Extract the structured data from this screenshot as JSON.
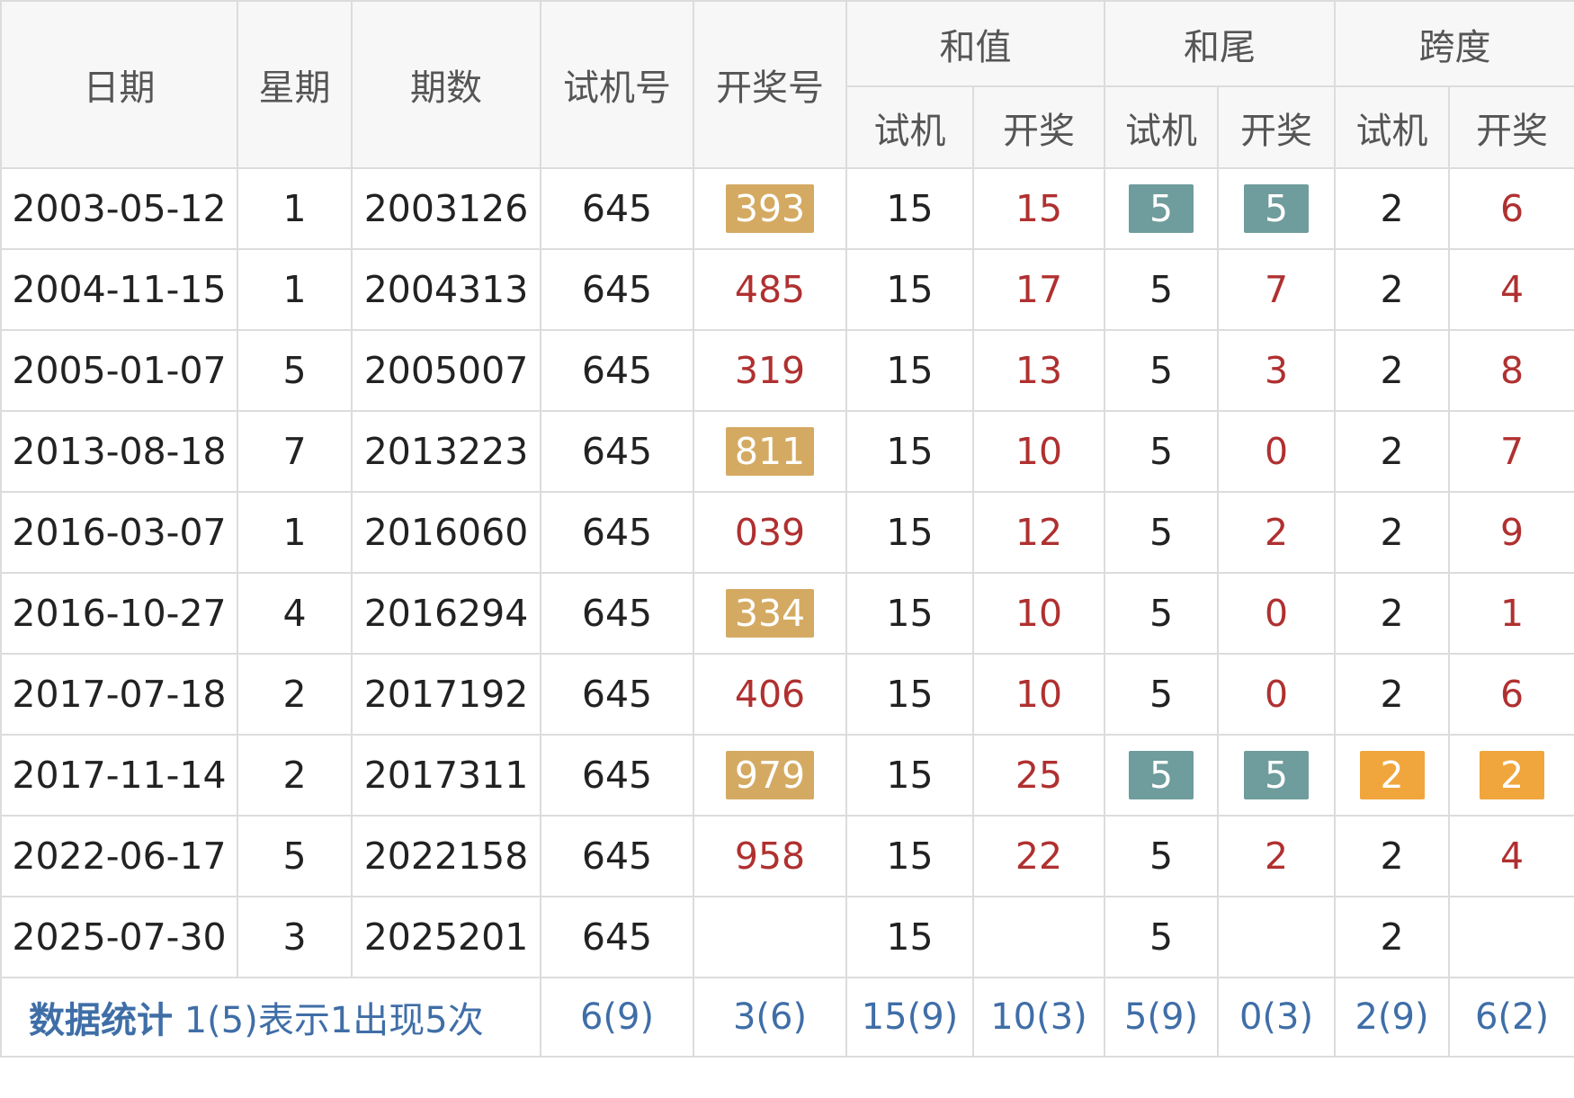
{
  "colors": {
    "header_bg": "#f7f7f7",
    "header_text": "#555555",
    "border": "#dcdcdc",
    "red_text": "#b03030",
    "gold_badge": "#d4aa63",
    "teal_badge": "#6f9c9c",
    "orange_badge": "#f0a63d",
    "stat_text": "#3f6ea7"
  },
  "header": {
    "date": "日期",
    "weekday": "星期",
    "issue": "期数",
    "trial_number": "试机号",
    "draw_number": "开奖号",
    "sum_group": "和值",
    "tail_group": "和尾",
    "span_group": "跨度",
    "sub_trial": "试机",
    "sub_draw": "开奖"
  },
  "rows": [
    {
      "date": "2003-05-12",
      "weekday": "1",
      "issue": "2003126",
      "trial": "645",
      "draw": "393",
      "draw_badge": "gold",
      "sum_trial": "15",
      "sum_draw": "15",
      "tail_trial": "5",
      "tail_trial_badge": "teal",
      "tail_draw": "5",
      "tail_draw_badge": "teal",
      "span_trial": "2",
      "span_trial_badge": "",
      "span_draw": "6",
      "span_draw_badge": ""
    },
    {
      "date": "2004-11-15",
      "weekday": "1",
      "issue": "2004313",
      "trial": "645",
      "draw": "485",
      "draw_badge": "",
      "sum_trial": "15",
      "sum_draw": "17",
      "tail_trial": "5",
      "tail_trial_badge": "",
      "tail_draw": "7",
      "tail_draw_badge": "",
      "span_trial": "2",
      "span_trial_badge": "",
      "span_draw": "4",
      "span_draw_badge": ""
    },
    {
      "date": "2005-01-07",
      "weekday": "5",
      "issue": "2005007",
      "trial": "645",
      "draw": "319",
      "draw_badge": "",
      "sum_trial": "15",
      "sum_draw": "13",
      "tail_trial": "5",
      "tail_trial_badge": "",
      "tail_draw": "3",
      "tail_draw_badge": "",
      "span_trial": "2",
      "span_trial_badge": "",
      "span_draw": "8",
      "span_draw_badge": ""
    },
    {
      "date": "2013-08-18",
      "weekday": "7",
      "issue": "2013223",
      "trial": "645",
      "draw": "811",
      "draw_badge": "gold",
      "sum_trial": "15",
      "sum_draw": "10",
      "tail_trial": "5",
      "tail_trial_badge": "",
      "tail_draw": "0",
      "tail_draw_badge": "",
      "span_trial": "2",
      "span_trial_badge": "",
      "span_draw": "7",
      "span_draw_badge": ""
    },
    {
      "date": "2016-03-07",
      "weekday": "1",
      "issue": "2016060",
      "trial": "645",
      "draw": "039",
      "draw_badge": "",
      "sum_trial": "15",
      "sum_draw": "12",
      "tail_trial": "5",
      "tail_trial_badge": "",
      "tail_draw": "2",
      "tail_draw_badge": "",
      "span_trial": "2",
      "span_trial_badge": "",
      "span_draw": "9",
      "span_draw_badge": ""
    },
    {
      "date": "2016-10-27",
      "weekday": "4",
      "issue": "2016294",
      "trial": "645",
      "draw": "334",
      "draw_badge": "gold",
      "sum_trial": "15",
      "sum_draw": "10",
      "tail_trial": "5",
      "tail_trial_badge": "",
      "tail_draw": "0",
      "tail_draw_badge": "",
      "span_trial": "2",
      "span_trial_badge": "",
      "span_draw": "1",
      "span_draw_badge": ""
    },
    {
      "date": "2017-07-18",
      "weekday": "2",
      "issue": "2017192",
      "trial": "645",
      "draw": "406",
      "draw_badge": "",
      "sum_trial": "15",
      "sum_draw": "10",
      "tail_trial": "5",
      "tail_trial_badge": "",
      "tail_draw": "0",
      "tail_draw_badge": "",
      "span_trial": "2",
      "span_trial_badge": "",
      "span_draw": "6",
      "span_draw_badge": ""
    },
    {
      "date": "2017-11-14",
      "weekday": "2",
      "issue": "2017311",
      "trial": "645",
      "draw": "979",
      "draw_badge": "gold",
      "sum_trial": "15",
      "sum_draw": "25",
      "tail_trial": "5",
      "tail_trial_badge": "teal",
      "tail_draw": "5",
      "tail_draw_badge": "teal",
      "span_trial": "2",
      "span_trial_badge": "orange",
      "span_draw": "2",
      "span_draw_badge": "orange"
    },
    {
      "date": "2022-06-17",
      "weekday": "5",
      "issue": "2022158",
      "trial": "645",
      "draw": "958",
      "draw_badge": "",
      "sum_trial": "15",
      "sum_draw": "22",
      "tail_trial": "5",
      "tail_trial_badge": "",
      "tail_draw": "2",
      "tail_draw_badge": "",
      "span_trial": "2",
      "span_trial_badge": "",
      "span_draw": "4",
      "span_draw_badge": ""
    },
    {
      "date": "2025-07-30",
      "weekday": "3",
      "issue": "2025201",
      "trial": "645",
      "draw": "",
      "draw_badge": "",
      "sum_trial": "15",
      "sum_draw": "",
      "tail_trial": "5",
      "tail_trial_badge": "",
      "tail_draw": "",
      "tail_draw_badge": "",
      "span_trial": "2",
      "span_trial_badge": "",
      "span_draw": "",
      "span_draw_badge": ""
    }
  ],
  "stats": {
    "label_bold": "数据统计",
    "label_desc": "1(5)表示1出现5次",
    "trial": "6(9)",
    "draw": "3(6)",
    "sum_trial": "15(9)",
    "sum_draw": "10(3)",
    "tail_trial": "5(9)",
    "tail_draw": "0(3)",
    "span_trial": "2(9)",
    "span_draw": "6(2)"
  }
}
